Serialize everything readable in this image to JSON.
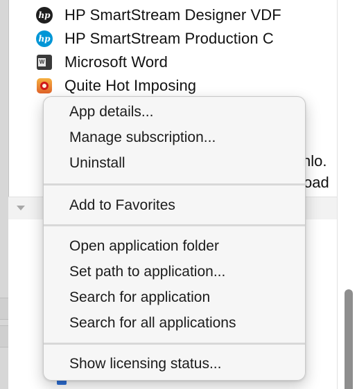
{
  "app_list": {
    "items": [
      {
        "name": "HP SmartStream Designer VDF",
        "icon": "hp-logo-icon-dark"
      },
      {
        "name": "HP SmartStream Production C",
        "icon": "hp-logo-icon-blue"
      },
      {
        "name": "Microsoft Word",
        "icon": "microsoft-word-icon"
      },
      {
        "name": "Quite Hot Imposing",
        "icon": "quite-hot-imposing-icon"
      }
    ],
    "clipped_texts": [
      "nlo.",
      "oad"
    ]
  },
  "context_menu": {
    "groups": [
      [
        "App details...",
        "Manage subscription...",
        "Uninstall"
      ],
      [
        "Add to Favorites"
      ],
      [
        "Open application folder",
        "Set path to application...",
        "Search for application",
        "Search for all applications"
      ],
      [
        "Show licensing status..."
      ]
    ]
  },
  "colors": {
    "hp_dark": "#1f1f1f",
    "hp_blue": "#0096d6",
    "menu_background": "#f6f6f6",
    "separator": "#d8d8d8",
    "scrollbar_thumb": "#8e8e8e"
  }
}
